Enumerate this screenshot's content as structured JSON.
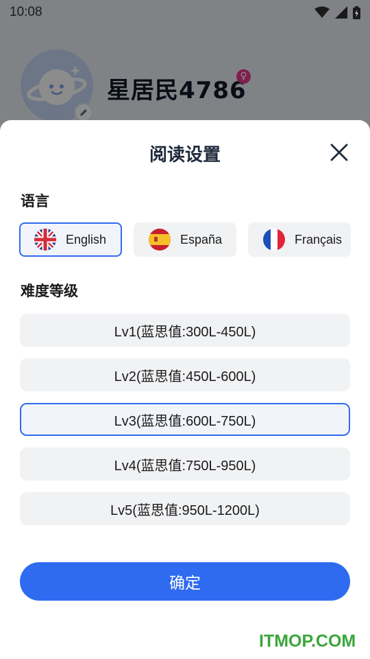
{
  "status_bar": {
    "time": "10:08"
  },
  "profile": {
    "username": "星居民4786",
    "gender_symbol": "♀"
  },
  "sheet": {
    "title": "阅读设置",
    "language_section_label": "语言",
    "languages": [
      {
        "label": "English",
        "selected": true,
        "flag": "uk-flag-icon"
      },
      {
        "label": "España",
        "selected": false,
        "flag": "spain-flag-icon"
      },
      {
        "label": "Français",
        "selected": false,
        "flag": "france-flag-icon"
      }
    ],
    "difficulty_section_label": "难度等级",
    "levels": [
      {
        "label": "Lv1(蓝思值:300L-450L)",
        "selected": false
      },
      {
        "label": "Lv2(蓝思值:450L-600L)",
        "selected": false
      },
      {
        "label": "Lv3(蓝思值:600L-750L)",
        "selected": true
      },
      {
        "label": "Lv4(蓝思值:750L-950L)",
        "selected": false
      },
      {
        "label": "Lv5(蓝思值:950L-1200L)",
        "selected": false
      }
    ],
    "confirm_label": "确定"
  },
  "colors": {
    "accent": "#2f6bf0",
    "option_bg": "#f1f2f4",
    "watermark": "#3aa63a"
  },
  "watermark": "ITMOP.COM"
}
